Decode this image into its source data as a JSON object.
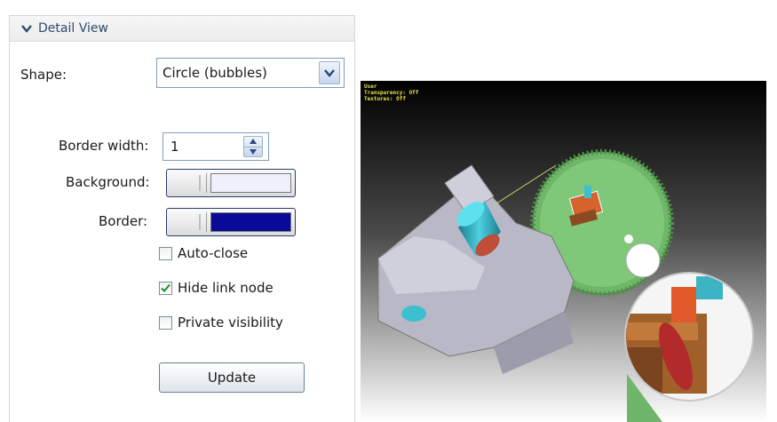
{
  "panel": {
    "header_title": "Detail View",
    "shape": {
      "label": "Shape:",
      "value": "Circle (bubbles)"
    },
    "border_width": {
      "label": "Border width:",
      "value": "1"
    },
    "background": {
      "label": "Background:",
      "color": "#eef0fb"
    },
    "border": {
      "label": "Border:",
      "color": "#0a0a99"
    },
    "checkboxes": [
      {
        "label": "Auto-close",
        "checked": false
      },
      {
        "label": "Hide link node",
        "checked": true
      },
      {
        "label": "Private visibility",
        "checked": false
      }
    ],
    "update_label": "Update"
  },
  "viewport": {
    "hud_lines": [
      "User",
      "Transparency: Off",
      "Textures: Off"
    ]
  }
}
